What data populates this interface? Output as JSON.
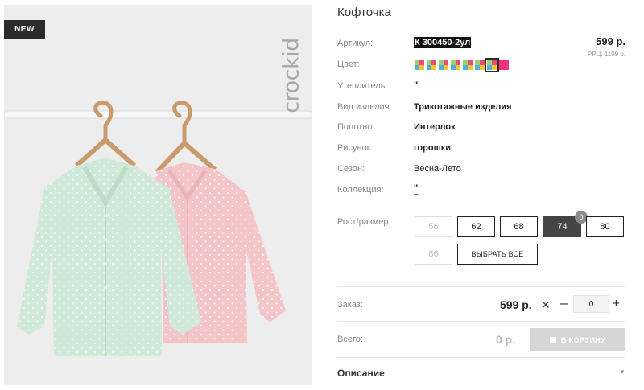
{
  "product_image": {
    "badge": "NEW",
    "brand_watermark": "crockid"
  },
  "product": {
    "title": "Кофточка",
    "price": "599 р.",
    "rrp": "РРЦ: 1199 р."
  },
  "specs": [
    {
      "label": "Артикул:",
      "value": "К 300450-2ул"
    },
    {
      "label": "Цвет:",
      "value": ""
    },
    {
      "label": "Утеплитель:",
      "value": "\""
    },
    {
      "label": "Вид изделия:",
      "value": "Трикотажные изделия"
    },
    {
      "label": "Полотно:",
      "value": "Интерлок"
    },
    {
      "label": "Рисунок:",
      "value": "горошки"
    },
    {
      "label": "Сезон:",
      "value": "Весна-Лето"
    },
    {
      "label": "Коллекция:",
      "value": "\""
    },
    {
      "label": "Рост/размер:",
      "value": ""
    }
  ],
  "collection_extra": "–",
  "color_swatches": [
    {
      "name": "multicolor",
      "color": "#e94b7a",
      "selected": false
    },
    {
      "name": "multicolor",
      "color": "#f3c236",
      "selected": false
    },
    {
      "name": "multicolor",
      "color": "#4fb3d9",
      "selected": false
    },
    {
      "name": "multicolor",
      "color": "#9bd06b",
      "selected": false
    },
    {
      "name": "multicolor",
      "color": "#e94b7a",
      "selected": false
    },
    {
      "name": "multicolor",
      "color": "#f3c236",
      "selected": false
    },
    {
      "name": "multicolor",
      "color": "#4fb3d9",
      "selected": true
    },
    {
      "name": "pink",
      "color": "#f0327a",
      "selected": false
    }
  ],
  "sizes": [
    {
      "label": "56",
      "state": "disabled"
    },
    {
      "label": "62",
      "state": "normal"
    },
    {
      "label": "68",
      "state": "normal"
    },
    {
      "label": "74",
      "state": "active",
      "count": "0"
    },
    {
      "label": "80",
      "state": "normal"
    },
    {
      "label": "86",
      "state": "disabled"
    }
  ],
  "select_all_label": "ВЫБРАТЬ ВСЕ",
  "order": {
    "label": "Заказ:",
    "price": "599 р.",
    "times": "✕",
    "minus": "–",
    "quantity": "0",
    "plus": "+"
  },
  "total": {
    "label": "Всего:",
    "value": "0 р.",
    "cart_button": "В КОРЗИНУ"
  },
  "description": {
    "label": "Описание",
    "chevron": "▼"
  },
  "colors": {
    "accent_dark": "#2b2b2b",
    "active_size": "#444444",
    "cart_disabled": "#d6d6d6",
    "jacket_mint": "#cfe8d8",
    "jacket_pink": "#f3c5c9"
  }
}
